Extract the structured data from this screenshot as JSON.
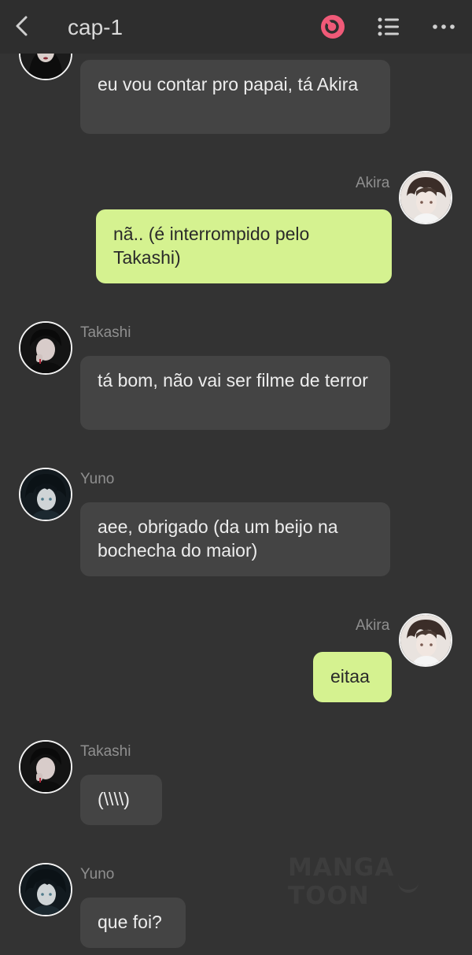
{
  "header": {
    "back_icon": "chevron-left-icon",
    "title": "cap-1",
    "record_icon": "record-icon",
    "list_icon": "list-icon",
    "more_icon": "more-dots-icon",
    "accent_color": "#f05a78"
  },
  "messages": [
    {
      "sender": "",
      "text": "eu vou contar pro papai, tá Akira",
      "side": "left",
      "avatar": "girl-avatar"
    },
    {
      "sender": "Akira",
      "text": "nã.. (é interrompido pelo Takashi)",
      "side": "right",
      "avatar": "akira-avatar"
    },
    {
      "sender": "Takashi",
      "text": "tá bom, não vai ser filme de terror",
      "side": "left",
      "avatar": "takashi-avatar"
    },
    {
      "sender": "Yuno",
      "text": "aee, obrigado (da um beijo na bochecha do maior)",
      "side": "left",
      "avatar": "yuno-avatar"
    },
    {
      "sender": "Akira",
      "text": "eitaa",
      "side": "right",
      "avatar": "akira-avatar"
    },
    {
      "sender": "Takashi",
      "text": "(\\\\\\\\)",
      "side": "left",
      "avatar": "takashi-avatar"
    },
    {
      "sender": "Yuno",
      "text": "que foi?",
      "side": "left",
      "avatar": "yuno-avatar"
    }
  ],
  "watermark": "MANGA TOON",
  "colors": {
    "background": "#333333",
    "other_bubble": "#444444",
    "my_bubble": "#d5f290"
  }
}
